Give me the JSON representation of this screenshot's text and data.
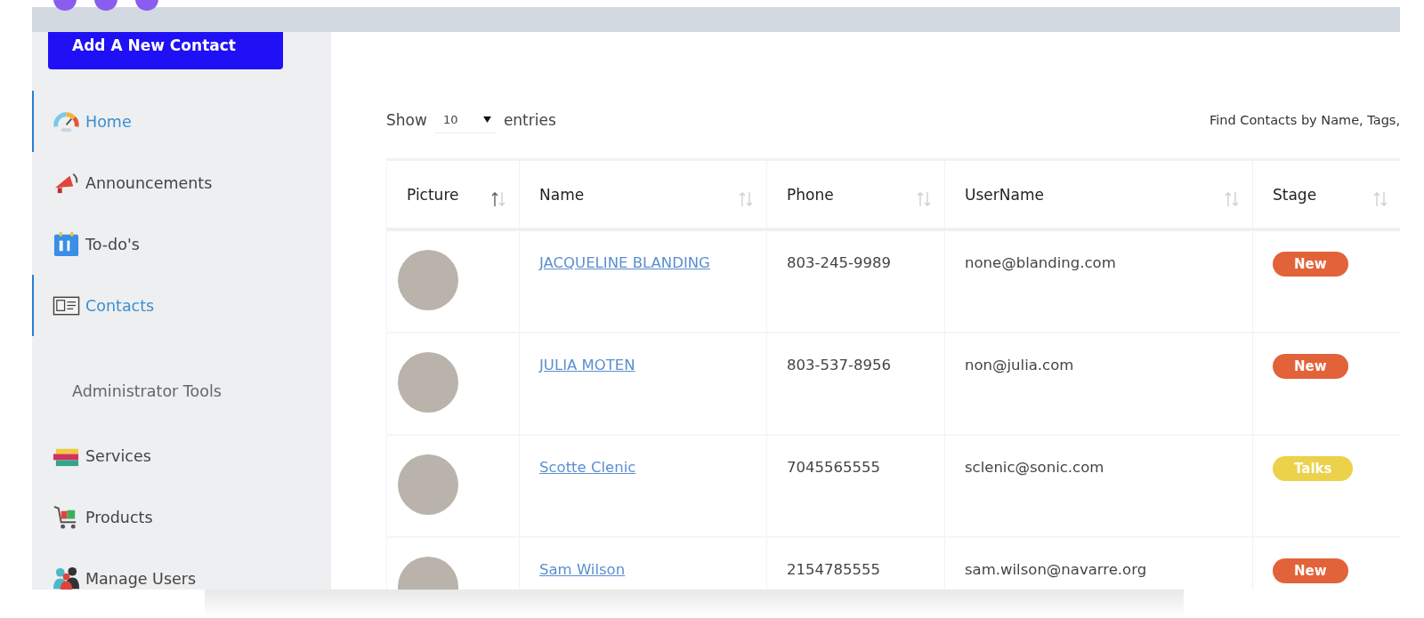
{
  "add_button": "Add A New Contact",
  "nav": [
    {
      "label": "Home",
      "kind": "link",
      "selected": true
    },
    {
      "label": "Announcements",
      "kind": "link",
      "selected": false
    },
    {
      "label": "To-do's",
      "kind": "link",
      "selected": false
    },
    {
      "label": "Contacts",
      "kind": "link",
      "selected": true
    },
    {
      "label": "Administrator Tools",
      "kind": "section",
      "selected": false
    },
    {
      "label": "Services",
      "kind": "link",
      "selected": false
    },
    {
      "label": "Products",
      "kind": "link",
      "selected": false
    },
    {
      "label": "Manage Users",
      "kind": "link",
      "selected": false
    }
  ],
  "length_menu": {
    "before": "Show",
    "value": "10",
    "after": "entries"
  },
  "search_label": "Find Contacts by Name, Tags,",
  "table": {
    "columns": [
      {
        "label": "Picture",
        "sorted": true
      },
      {
        "label": "Name",
        "sorted": false
      },
      {
        "label": "Phone",
        "sorted": false
      },
      {
        "label": "UserName",
        "sorted": false
      },
      {
        "label": "Stage",
        "sorted": false
      }
    ],
    "rows": [
      {
        "name": "JACQUELINE BLANDING",
        "phone": "803-245-9989",
        "username": "none@blanding.com",
        "stage": "New",
        "color": "#e2623a"
      },
      {
        "name": "JULIA MOTEN",
        "phone": "803-537-8956",
        "username": "non@julia.com",
        "stage": "New",
        "color": "#e2623a"
      },
      {
        "name": "Scotte Clenic",
        "phone": "7045565555",
        "username": "sclenic@sonic.com",
        "stage": "Talks",
        "color": "#ecd14a"
      },
      {
        "name": "Sam Wilson",
        "phone": "2154785555",
        "username": "sam.wilson@navarre.org",
        "stage": "New",
        "color": "#e2623a"
      }
    ]
  }
}
